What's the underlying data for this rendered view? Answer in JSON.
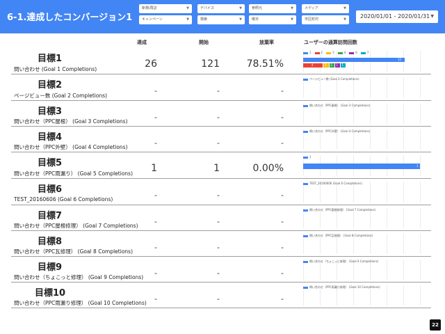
{
  "header": {
    "title": "6-1.達成したコンバージョン1",
    "filters": [
      {
        "label": "新規/再訪"
      },
      {
        "label": "デバイス"
      },
      {
        "label": "参照元"
      },
      {
        "label": "メディア"
      },
      {
        "label": "キャンペーン"
      },
      {
        "label": "検索"
      },
      {
        "label": "曜日"
      },
      {
        "label": "市区町村"
      }
    ],
    "date_range": "2020/01/01 - 2020/01/31"
  },
  "columns": {
    "achieved": "達成",
    "started": "開始",
    "rate": "放棄率",
    "visits": "ユーザーの通算訪問回数"
  },
  "goals": [
    {
      "title": "目標1",
      "subtitle": "問い合わせ (Goal 1 Completions)",
      "achieved": "26",
      "started": "121",
      "rate": "78.51%",
      "chart_label": ""
    },
    {
      "title": "目標2",
      "subtitle": "ページビュー数 (Goal 2 Completions)",
      "achieved": "-",
      "started": "-",
      "rate": "-",
      "chart_label": "ページビュー数 (Goal 2 Completions)"
    },
    {
      "title": "目標3",
      "subtitle": "問い合わせ（PPC屋根） (Goal 3 Completions)",
      "achieved": "-",
      "started": "-",
      "rate": "-",
      "chart_label": "問い合わせ（PPC屋根） (Goal 3 Completions)"
    },
    {
      "title": "目標4",
      "subtitle": "問い合わせ（PPC外壁） (Goal 4 Completions)",
      "achieved": "-",
      "started": "-",
      "rate": "-",
      "chart_label": "問い合わせ（PPC外壁） (Goal 4 Completions)"
    },
    {
      "title": "目標5",
      "subtitle": "問い合わせ（PPC雨漏り） (Goal 5 Completions)",
      "achieved": "1",
      "started": "1",
      "rate": "0.00%",
      "chart_label": "1"
    },
    {
      "title": "目標6",
      "subtitle": "TEST_20160606 (Goal 6 Completions)",
      "achieved": "-",
      "started": "-",
      "rate": "-",
      "chart_label": "TEST_20160606 (Goal 6 Completions)"
    },
    {
      "title": "目標7",
      "subtitle": "問い合わせ（PPC屋根修理） (Goal 7 Completions)",
      "achieved": "-",
      "started": "-",
      "rate": "-",
      "chart_label": "問い合わせ（PPC屋根修理） (Goal 7 Completions)"
    },
    {
      "title": "目標8",
      "subtitle": "問い合わせ（PPC瓦修理） (Goal 8 Completions)",
      "achieved": "-",
      "started": "-",
      "rate": "-",
      "chart_label": "問い合わせ（PPC瓦修理） (Goal 8 Completions)"
    },
    {
      "title": "目標9",
      "subtitle": "問い合わせ（ちょこっと修理） (Goal 9 Completions)",
      "achieved": "-",
      "started": "-",
      "rate": "-",
      "chart_label": "問い合わせ（ちょこっと修理） (Goal 9 Completions)"
    },
    {
      "title": "目標10",
      "subtitle": "問い合わせ（PPC雨漏り修理） (Goal 10 Completions)",
      "achieved": "-",
      "started": "-",
      "rate": "-",
      "chart_label": "問い合わせ（PPC雨漏り修理） (Goal 10 Completions)"
    }
  ],
  "chart_data": [
    {
      "type": "bar",
      "stacked": true,
      "categories": [
        "目標1"
      ],
      "series": [
        {
          "name": "1",
          "color": "#4285f4",
          "values": [
            12
          ]
        },
        {
          "name": "2",
          "color": "#ea4335",
          "values": [
            4
          ]
        },
        {
          "name": "3",
          "color": "#fbbc04",
          "values": [
            3
          ]
        },
        {
          "name": "4",
          "color": "#34a853",
          "values": [
            1
          ]
        },
        {
          "name": "6",
          "color": "#9c27b0",
          "values": [
            1
          ]
        },
        {
          "name": "7",
          "color": "#00acc1",
          "values": [
            1
          ]
        }
      ]
    },
    {
      "type": "bar",
      "categories": [
        "目標5"
      ],
      "series": [
        {
          "name": "1",
          "color": "#4285f4",
          "values": [
            1
          ]
        }
      ]
    }
  ],
  "page_number": "22"
}
